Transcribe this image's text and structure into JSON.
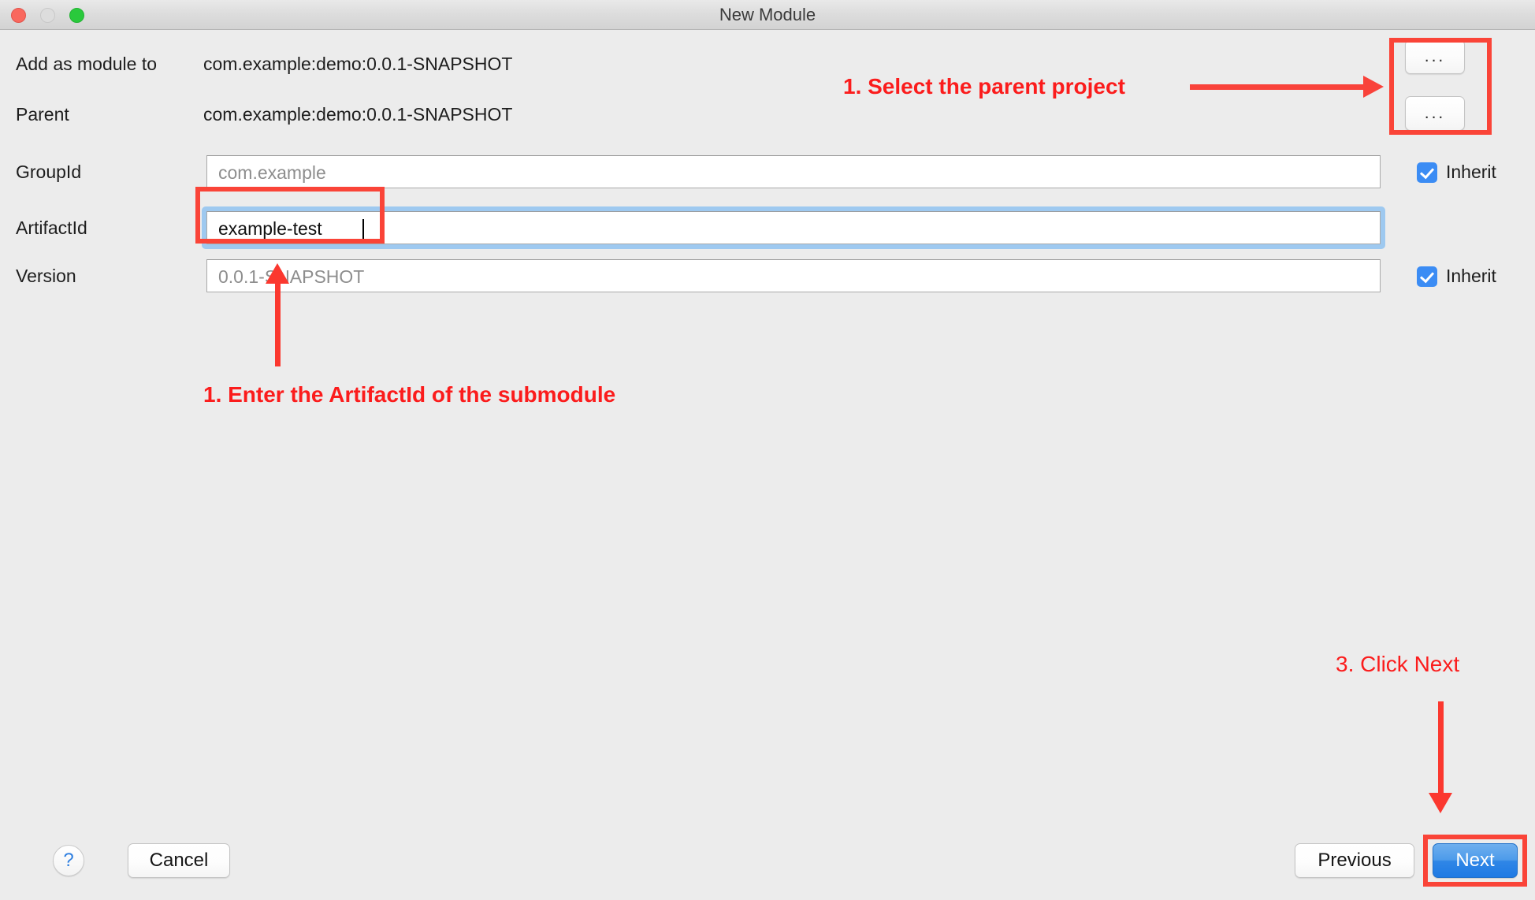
{
  "window": {
    "title": "New Module",
    "traffic_lights": {
      "close": "close-button",
      "minimize": "minimize-button",
      "maximize": "maximize-button"
    },
    "colors": {
      "background": "#ececec",
      "titlebar": "#dcdcdc",
      "close": "#f9685e",
      "minimize": "#dddddd",
      "maximize": "#2ac93c",
      "accent_blue": "#3b8cf4",
      "primary_button": "#2f86e6",
      "annotation_red": "#fb1c1c",
      "annotation_rect": "#fa4438"
    }
  },
  "form": {
    "rows": [
      {
        "label": "Add as module to",
        "value": "com.example:demo:0.0.1-SNAPSHOT",
        "type": "static"
      },
      {
        "label": "Parent",
        "value": "com.example:demo:0.0.1-SNAPSHOT",
        "type": "static"
      },
      {
        "label": "GroupId",
        "value": "com.example",
        "type": "input",
        "state": "placeholder",
        "inherit": true,
        "inherit_label": "Inherit"
      },
      {
        "label": "ArtifactId",
        "value": "example-test",
        "type": "input",
        "state": "filled",
        "focused": true,
        "inherit": false
      },
      {
        "label": "Version",
        "value": "0.0.1-SNAPSHOT",
        "type": "input",
        "state": "placeholder",
        "inherit": true,
        "inherit_label": "Inherit"
      }
    ],
    "browse_buttons": [
      {
        "label": "...",
        "name": "add-as-module-browse"
      },
      {
        "label": "...",
        "name": "parent-browse"
      }
    ]
  },
  "footer": {
    "help_label": "?",
    "cancel_label": "Cancel",
    "previous_label": "Previous",
    "next_label": "Next"
  },
  "annotations": [
    {
      "id": "a1",
      "text": "1. Select the parent project",
      "style": "bold"
    },
    {
      "id": "a2",
      "text": "1. Enter the ArtifactId of the submodule",
      "style": "bold"
    },
    {
      "id": "a3",
      "text": "3. Click Next",
      "style": "plain"
    }
  ]
}
